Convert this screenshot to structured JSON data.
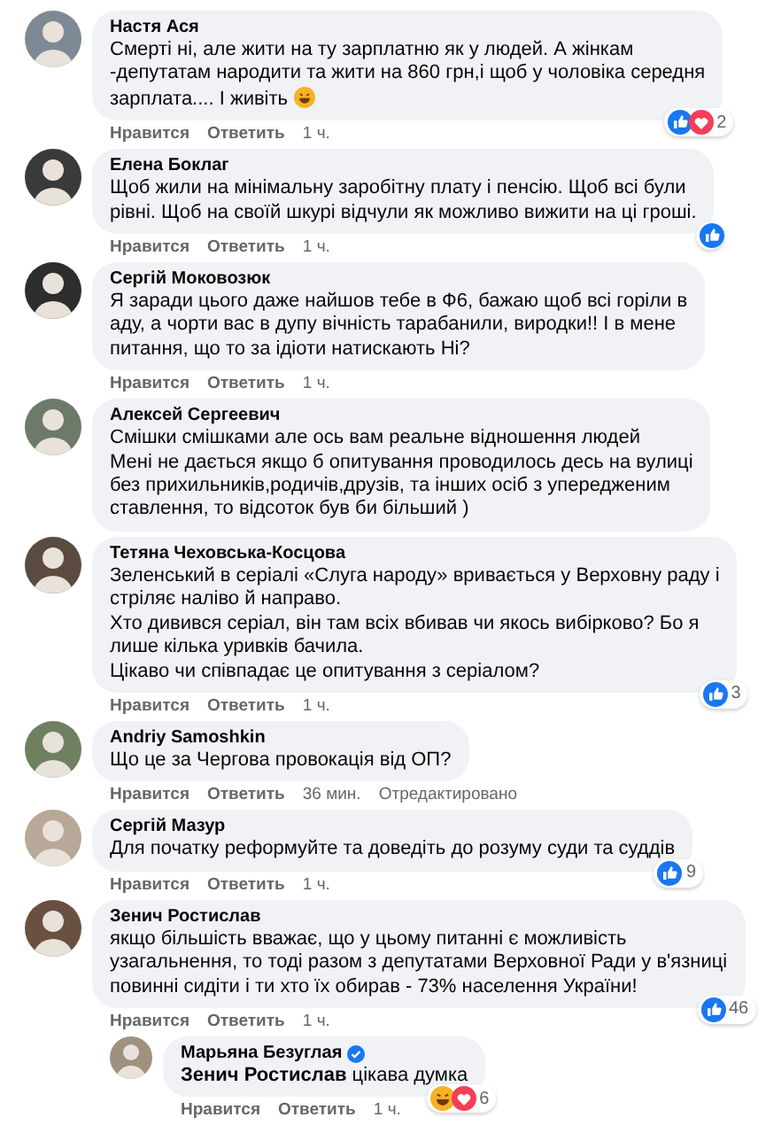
{
  "comments": [
    {
      "author": "Настя Ася",
      "lines": [
        "Смерті ні, але жити на ту зарплатню як у людей. А жінкам",
        "-депутатам народити та жити на 860 грн,і щоб у чоловіка середня",
        "зарплата.... І живіть"
      ],
      "trailing_emoji": true,
      "reactions": {
        "icons": [
          {
            "kind": "like"
          },
          {
            "kind": "love"
          }
        ],
        "count": "2"
      },
      "actions": {
        "like": "Нравится",
        "reply": "Ответить",
        "time": "1 ч."
      }
    },
    {
      "author": "Елена Боклаг",
      "lines": [
        "Щоб жили на мінімальну заробітну плату і пенсію. Щоб всі були",
        "рівні. Щоб на своїй шкурі відчули як можливо вижити на ці гроші."
      ],
      "reactions": {
        "icons": [
          {
            "kind": "like"
          }
        ]
      },
      "actions": {
        "like": "Нравится",
        "reply": "Ответить",
        "time": "1 ч."
      }
    },
    {
      "author": "Сергій Моковозюк",
      "lines": [
        "Я заради цього даже найшов тебе в Ф6, бажаю щоб всі горіли в",
        "аду, а чорти вас в дупу вічність тарабанили, виродки!! І в мене",
        "питання, що то за ідіоти натискають Ні?"
      ],
      "actions": {
        "like": "Нравится",
        "reply": "Ответить",
        "time": "1 ч."
      }
    },
    {
      "author": "Алексей Сергеевич",
      "lines": [
        "Смішки смішками але ось вам реальне відношення людей",
        "Мені не дається якщо б опитування проводилось десь на вулиці",
        "без прихильників,родичів,друзів, та інших осіб з упередженим",
        "ставлення, то відсоток був би більший )"
      ]
    },
    {
      "author": "Тетяна Чеховська-Косцова",
      "lines": [
        "Зеленський в серіалі «Слуга народу» вривається у Верховну раду і",
        "стріляє наліво й направо.",
        "Хто дивився серіал, він там всіх вбивав чи якось вибірково? Бо я",
        "лише кілька уривків бачила.",
        "Цікаво чи співпадає це опитування з серіалом?"
      ],
      "reactions": {
        "icons": [
          {
            "kind": "like"
          }
        ],
        "count": "3"
      },
      "actions": {
        "like": "Нравится",
        "reply": "Ответить",
        "time": "1 ч."
      }
    },
    {
      "author": "Andriy Samoshkin",
      "lines": [
        "Що це за Чергова провокація від ОП?"
      ],
      "actions": {
        "like": "Нравится",
        "reply": "Ответить",
        "time": "36 мин.",
        "edited": "Отредактировано"
      }
    },
    {
      "author": "Сергій Мазур",
      "lines": [
        "Для початку реформуйте та доведіть до розуму суди та суддів"
      ],
      "reactions": {
        "icons": [
          {
            "kind": "like"
          }
        ],
        "count": "9"
      },
      "actions": {
        "like": "Нравится",
        "reply": "Ответить",
        "time": "1 ч."
      }
    },
    {
      "author": "Зенич Ростислав",
      "lines": [
        "якщо більшість вважає, що у цьому питанні є можливість",
        "узагальнення, то тоді разом з депутатами Верховної Ради у в'язниці",
        "повинні сидіти і ти хто їх обирав - 73% населення України!"
      ],
      "reactions": {
        "icons": [
          {
            "kind": "like"
          }
        ],
        "count": "46"
      },
      "actions": {
        "like": "Нравится",
        "reply": "Ответить",
        "time": "1 ч."
      },
      "replies": [
        {
          "author": "Марьяна Безуглая",
          "verified": true,
          "lines": [
            "**Зенич Ростислав** цікава думка"
          ],
          "reactions": {
            "icons": [
              {
                "kind": "haha"
              },
              {
                "kind": "love"
              }
            ],
            "count": "6"
          },
          "actions": {
            "like": "Нравится",
            "reply": "Ответить",
            "time": "1 ч."
          }
        }
      ]
    }
  ]
}
